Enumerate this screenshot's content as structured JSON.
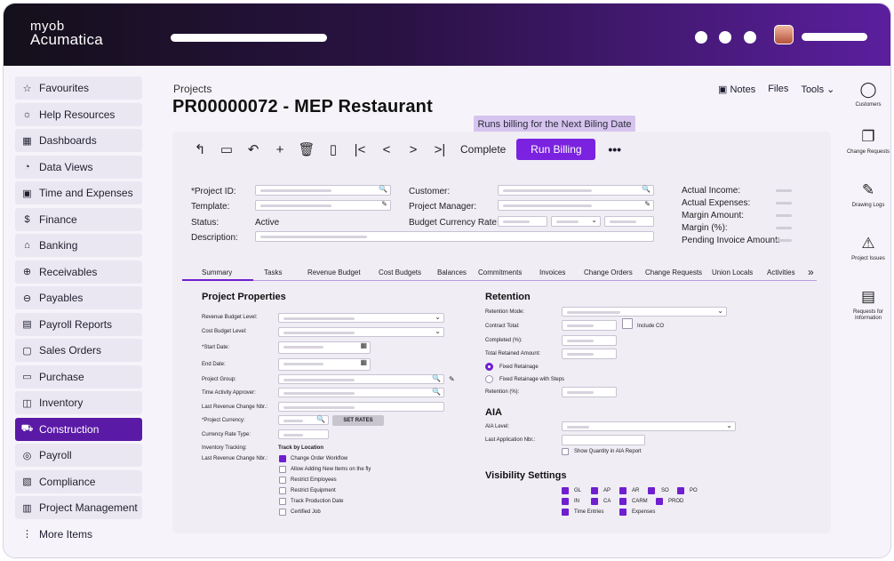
{
  "brand": {
    "line1": "myob",
    "line2": "Acumatica"
  },
  "sidebar": {
    "items": [
      {
        "icon": "☆",
        "label": "Favourites"
      },
      {
        "icon": "☼",
        "label": "Help Resources"
      },
      {
        "icon": "▦",
        "label": "Dashboards"
      },
      {
        "icon": "◔",
        "label": "Data Views"
      },
      {
        "icon": "▣",
        "label": "Time and Expenses"
      },
      {
        "icon": "$",
        "label": "Finance"
      },
      {
        "icon": "⌂",
        "label": "Banking"
      },
      {
        "icon": "⊕",
        "label": "Receivables"
      },
      {
        "icon": "⊖",
        "label": "Payables"
      },
      {
        "icon": "▤",
        "label": "Payroll Reports"
      },
      {
        "icon": "▢",
        "label": "Sales Orders"
      },
      {
        "icon": "▭",
        "label": "Purchase"
      },
      {
        "icon": "◫",
        "label": "Inventory"
      },
      {
        "icon": "⛟",
        "label": "Construction"
      },
      {
        "icon": "◎",
        "label": "Payroll"
      },
      {
        "icon": "▧",
        "label": "Compliance"
      },
      {
        "icon": "▥",
        "label": "Project Management"
      },
      {
        "icon": "⋮",
        "label": "More Items"
      }
    ]
  },
  "header": {
    "breadcrumb": "Projects",
    "title": "PR00000072 - MEP Restaurant",
    "notes": "Notes",
    "files": "Files",
    "tools": "Tools",
    "tooltip": "Runs billing for the Next Biling Date"
  },
  "toolbar": {
    "complete": "Complete",
    "run_billing": "Run Billing",
    "more": "•••"
  },
  "form": {
    "project_id": "*Project ID:",
    "template": "Template:",
    "status": "Status:",
    "status_value": "Active",
    "description": "Description:",
    "customer": "Customer:",
    "project_manager": "Project Manager:",
    "budget_currency_rate": "Budget Currency Rate:",
    "actual_income": "Actual Income:",
    "actual_expenses": "Actual Expenses:",
    "margin_amount": "Margin Amount:",
    "margin_pct": "Margin (%):",
    "pending_invoice": "Pending Invoice Amount:"
  },
  "tabs": [
    "Summary",
    "Tasks",
    "Revenue Budget",
    "Cost Budgets",
    "Balances",
    "Commitments",
    "Invoices",
    "Change Orders",
    "Change Requests",
    "Union Locals",
    "Activities"
  ],
  "tabs_more": "»",
  "project_properties": {
    "title": "Project Properties",
    "revenue_budget_level": "Revenue Budget Level:",
    "cost_budget_level": "Cost Budget Level:",
    "start_date": "*Start Date:",
    "end_date": "End Date:",
    "project_group": "Project Group:",
    "time_activity_approver": "Time Activity Approver:",
    "last_revenue_change_nbr": "Last Revenue Change Nbr.:",
    "project_currency": "*Project Currency:",
    "set_rates": "SET RATES",
    "currency_rate_type": "Currency Rate Type:",
    "inventory_tracking": "Inventory Tracking:",
    "track_by_location": "Track by Location",
    "last_revenue_change_nbr2": "Last Revenue Change Nbr.:",
    "checks": [
      {
        "label": "Change Order Workflow",
        "checked": true
      },
      {
        "label": "Allow Adding New Items on the fly",
        "checked": false
      },
      {
        "label": "Restrict Employees",
        "checked": false
      },
      {
        "label": "Restrict Equipment",
        "checked": false
      },
      {
        "label": "Track Production Date",
        "checked": false
      },
      {
        "label": "Certified Job",
        "checked": false
      }
    ]
  },
  "retention": {
    "title": "Retention",
    "mode": "Retention Mode:",
    "contract_total": "Contract Total:",
    "include_co": "Include CO",
    "completed": "Completed (%):",
    "total_retained": "Total Retained Amount:",
    "fixed": "Fixed Retainage",
    "fixed_steps": "Fixed Retainage with Steps",
    "retention_pct": "Retention (%):"
  },
  "aia": {
    "title": "AIA",
    "level": "AIA Level:",
    "last_app": "Last Application Nbr.:",
    "show_qty": "Show Quantity in AIA Report"
  },
  "visibility": {
    "title": "Visibility Settings",
    "row1": [
      "GL",
      "AP",
      "AR",
      "SO",
      "PO"
    ],
    "row2": [
      "IN",
      "CA",
      "CARM",
      "PROD"
    ],
    "row3": [
      "Time Entries",
      "Expenses"
    ]
  },
  "rightbar": [
    {
      "icon": "◯",
      "label": "Customers"
    },
    {
      "icon": "❐",
      "label": "Change Requests"
    },
    {
      "icon": "✎",
      "label": "Drawing Logs"
    },
    {
      "icon": "⚠",
      "label": "Project Issues"
    },
    {
      "icon": "▤",
      "label": "Requests for Information"
    }
  ],
  "colors": {
    "accent": "#6f1fd0",
    "active_nav": "#5a1aa6",
    "topbar_end": "#5b1f9e"
  }
}
